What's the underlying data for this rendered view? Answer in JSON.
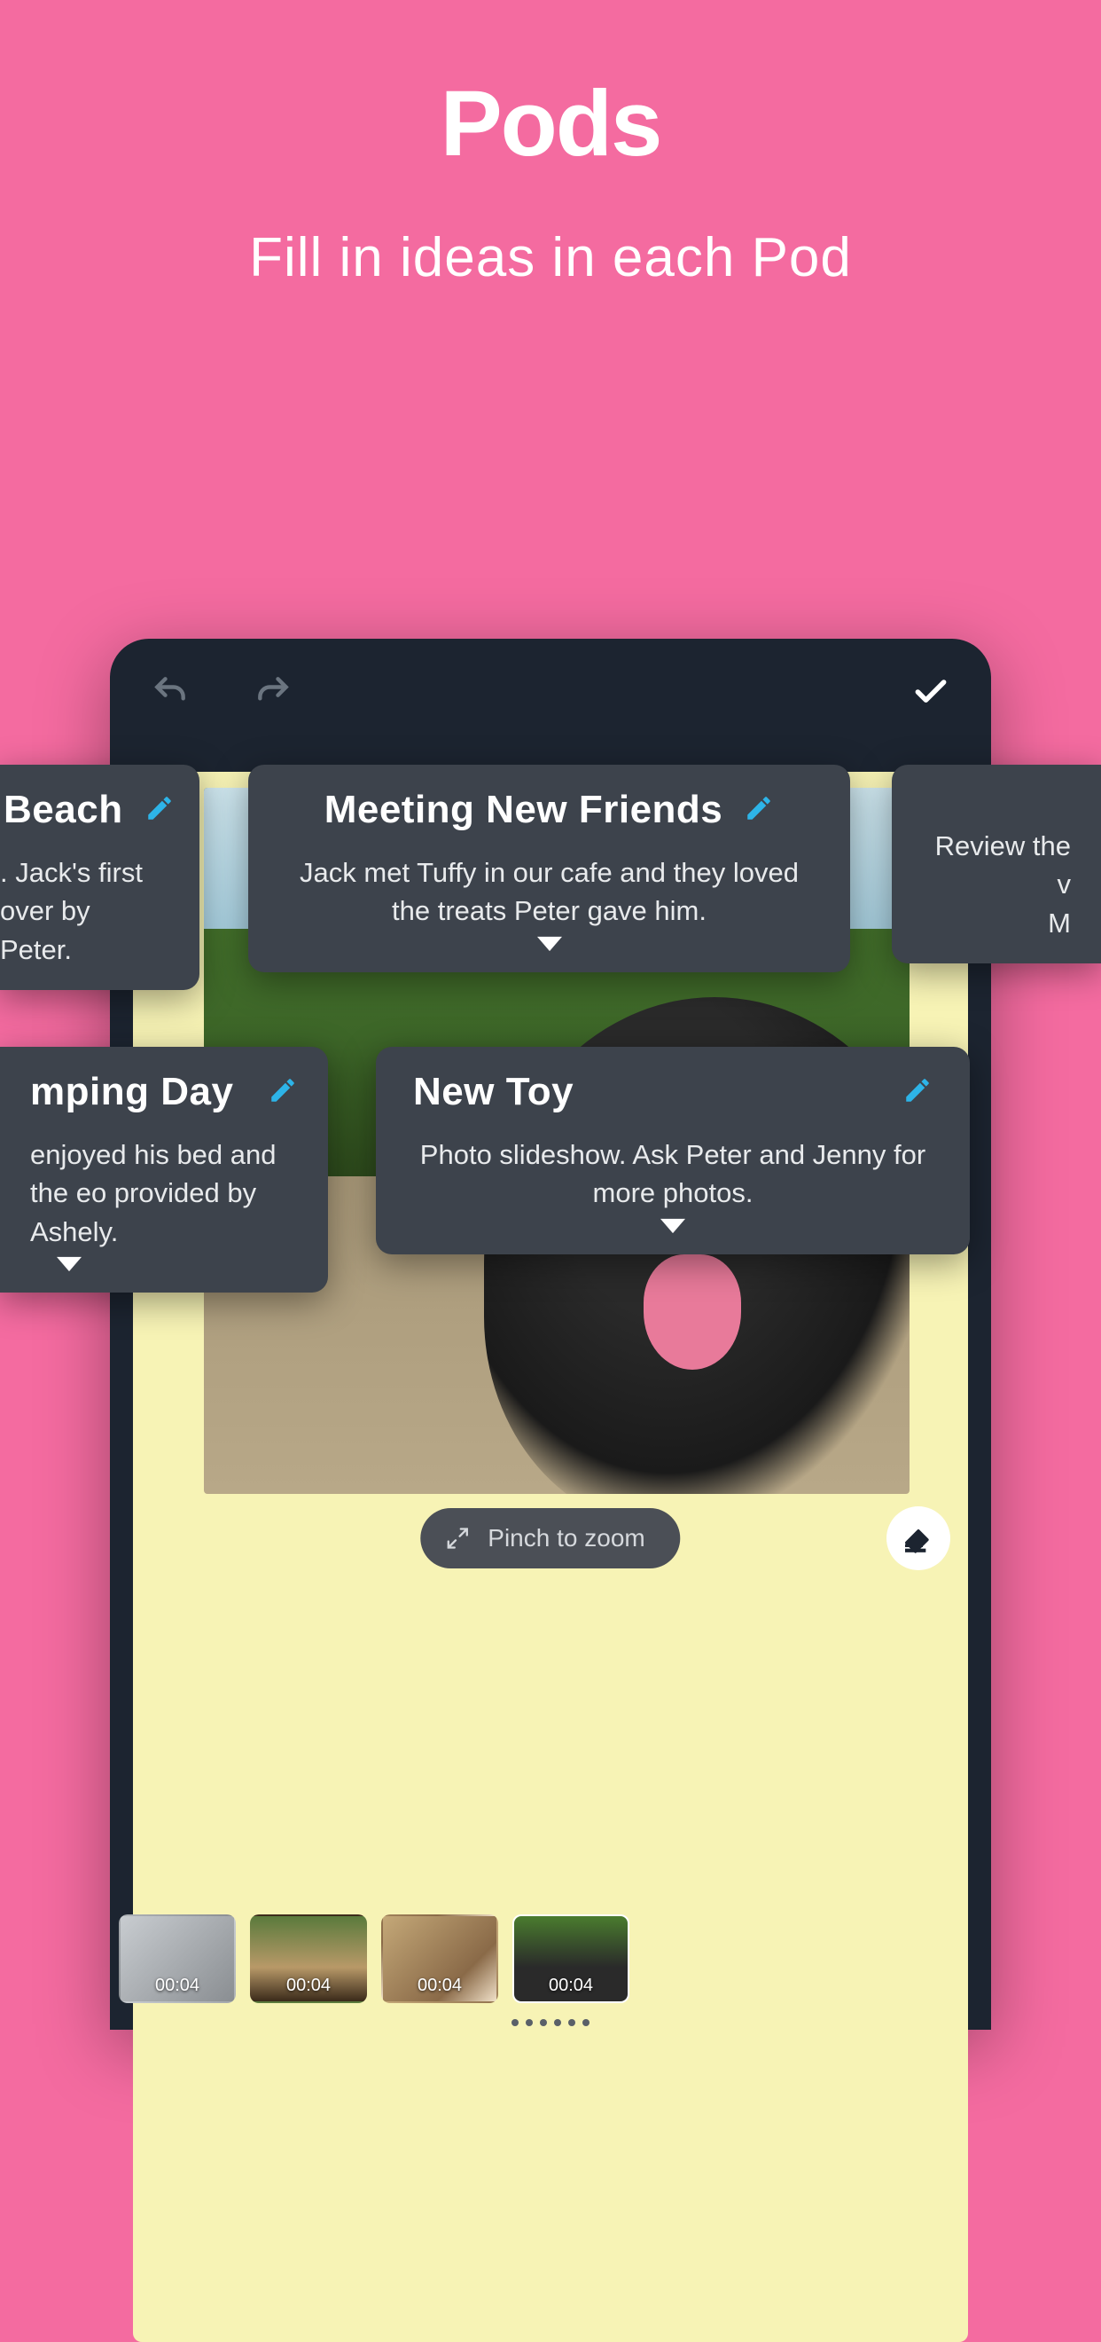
{
  "hero": {
    "title": "Pods",
    "subtitle": "Fill in ideas in each Pod"
  },
  "zoom_label": "Pinch to zoom",
  "pods": {
    "beach": {
      "title": "Beach",
      "desc": ". Jack's first\nover by Peter."
    },
    "meeting": {
      "title": "Meeting New Friends",
      "desc": "Jack met Tuffy in our cafe and they loved the treats Peter gave him."
    },
    "review": {
      "title": "",
      "desc": "Review the v\nM"
    },
    "camping": {
      "title": "mping Day",
      "desc": "enjoyed his bed and the eo provided by Ashely."
    },
    "newtoy": {
      "title": "New Toy",
      "desc": "Photo slideshow. Ask Peter and Jenny for more photos."
    }
  },
  "clips": [
    {
      "duration": "00:04"
    },
    {
      "duration": "00:04"
    },
    {
      "duration": "00:04"
    },
    {
      "duration": "00:04"
    }
  ]
}
